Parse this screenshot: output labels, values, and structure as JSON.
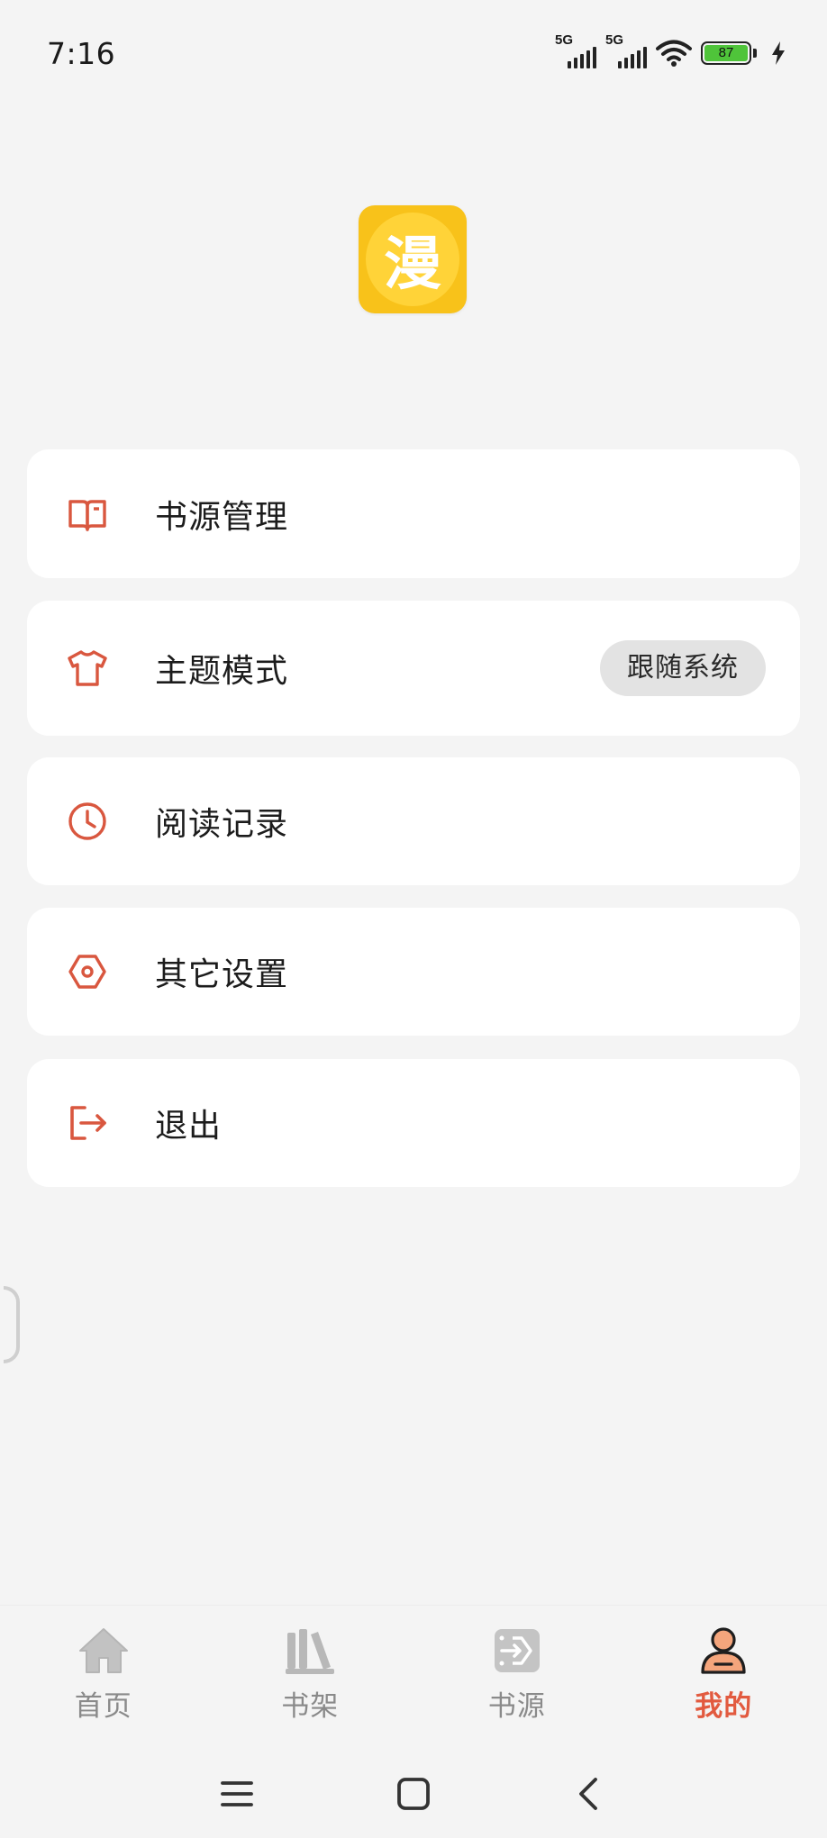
{
  "status_bar": {
    "time": "7:16",
    "signal_1_label": "5G",
    "signal_2_label": "5G",
    "battery_level": "87",
    "charging": true
  },
  "app": {
    "logo_char": "漫",
    "logo_color": "#f8c21a"
  },
  "menu": [
    {
      "label": "书源管理",
      "icon": "book-open-icon"
    },
    {
      "label": "主题模式",
      "icon": "tshirt-icon",
      "chip": "跟随系统"
    },
    {
      "label": "阅读记录",
      "icon": "clock-icon"
    },
    {
      "label": "其它设置",
      "icon": "settings-hexagon-icon"
    },
    {
      "label": "退出",
      "icon": "logout-icon"
    }
  ],
  "bottom_nav": [
    {
      "label": "首页",
      "icon": "home-icon",
      "active": false
    },
    {
      "label": "书架",
      "icon": "bookshelf-icon",
      "active": false
    },
    {
      "label": "书源",
      "icon": "source-icon",
      "active": false
    },
    {
      "label": "我的",
      "icon": "profile-icon",
      "active": true
    }
  ],
  "colors": {
    "accent": "#e25a3f",
    "icon": "#d9573f",
    "background": "#f4f4f4",
    "card": "#ffffff",
    "inactive_nav": "#8a8a8a"
  }
}
